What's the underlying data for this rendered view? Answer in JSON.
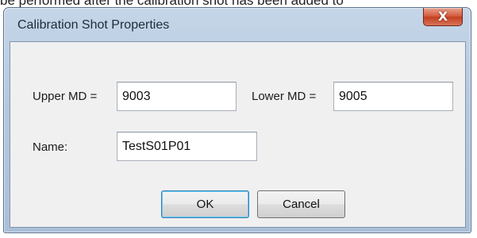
{
  "background": {
    "text": "be performed after the calibration shot has been added to"
  },
  "dialog": {
    "title": "Calibration Shot Properties",
    "close_symbol": "X",
    "upper_md_label": "Upper MD =",
    "upper_md_value": "9003",
    "lower_md_label": "Lower MD =",
    "lower_md_value": "9005",
    "name_label": "Name:",
    "name_value": "TestS01P01",
    "ok_label": "OK",
    "cancel_label": "Cancel"
  },
  "colors": {
    "close_button": "#c94a2b",
    "client_bg": "#f0f0f0",
    "frame": "#b5c9df",
    "default_button_border": "#3c7fb1"
  }
}
